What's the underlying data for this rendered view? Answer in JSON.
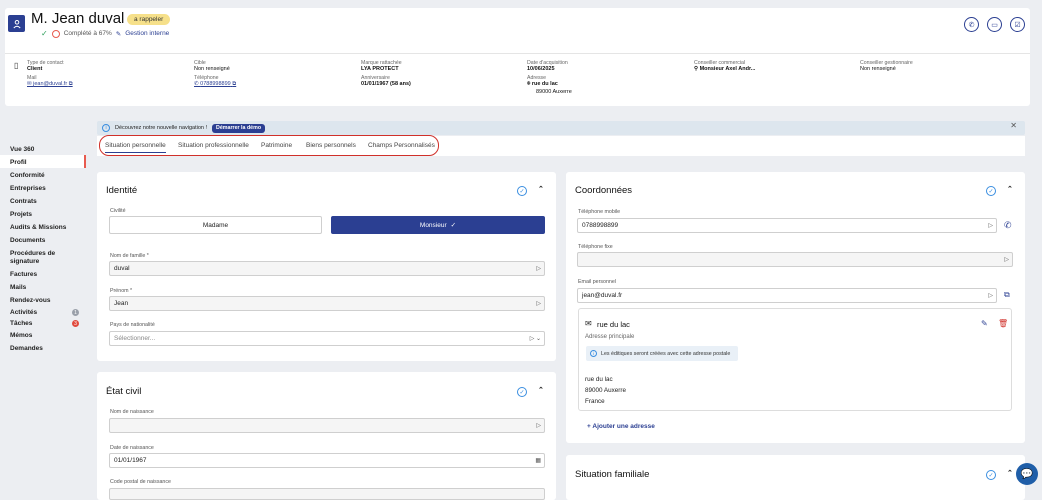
{
  "header": {
    "name": "M. Jean duval",
    "status_badge": "a rappeler",
    "completion": "Complété à 67%",
    "gestion_link": "Gestion interne",
    "fields": [
      {
        "label": "Type de contact",
        "value": "Client"
      },
      {
        "label": "Mail",
        "value": "jean@duval.fr"
      },
      {
        "label": "Cible",
        "value": "Non renseigné"
      },
      {
        "label": "Téléphone",
        "value": "0788998899"
      },
      {
        "label": "Marque rattachée",
        "value": "LYA PROTECT"
      },
      {
        "label": "Anniversaire",
        "value": "01/01/1967 (58 ans)"
      },
      {
        "label": "Date d'acquisition",
        "value": "10/06/2025"
      },
      {
        "label": "Adresse",
        "value": "rue du lac",
        "value2": "89000 Auxerre"
      },
      {
        "label": "Conseiller commercial",
        "value": "Monsieur Axel Andr..."
      },
      {
        "label": "Conseiller gestionnaire",
        "value": "Non renseigné"
      }
    ]
  },
  "sidebar": {
    "items": [
      "Vue 360",
      "Profil",
      "Conformité",
      "Entreprises",
      "Contrats",
      "Projets",
      "Audits & Missions",
      "Documents",
      "Procédures de signature",
      "Factures",
      "Mails",
      "Rendez-vous",
      "Activités",
      "Tâches",
      "Mémos",
      "Demandes"
    ],
    "badges": {
      "activites": "1",
      "taches": "3"
    }
  },
  "banner": {
    "text": "Découvrez notre nouvelle navigation !",
    "button": "Démarrer la démo"
  },
  "tabs": [
    "Situation personnelle",
    "Situation professionnelle",
    "Patrimoine",
    "Biens personnels",
    "Champs Personnalisés"
  ],
  "identite": {
    "title": "Identité",
    "civilite_label": "Civilité",
    "option_madame": "Madame",
    "option_monsieur": "Monsieur",
    "nom_label": "Nom de famille *",
    "nom_value": "duval",
    "prenom_label": "Prénom *",
    "prenom_value": "Jean",
    "pays_label": "Pays de nationalité",
    "pays_placeholder": "Sélectionner..."
  },
  "etat_civil": {
    "title": "État civil",
    "nom_naissance_label": "Nom de naissance",
    "date_naissance_label": "Date de naissance",
    "date_naissance_value": "01/01/1967",
    "cp_naissance_label": "Code postal de naissance"
  },
  "coordonnees": {
    "title": "Coordonnées",
    "tel_mobile_label": "Téléphone mobile",
    "tel_mobile_value": "0788998899",
    "tel_fixe_label": "Téléphone fixe",
    "email_label": "Email personnel",
    "email_value": "jean@duval.fr",
    "address_title": "rue du lac",
    "address_type": "Adresse principale",
    "address_note": "Les éditiques seront créées avec cette adresse postale",
    "address_lines": [
      "rue du lac",
      "89000 Auxerre",
      "France"
    ],
    "add_address": "Ajouter une adresse"
  },
  "situation_familiale": {
    "title": "Situation familiale"
  },
  "colors": {
    "primary": "#2b3f92",
    "accent": "#3a8ee0",
    "badge": "#f6e08a",
    "danger": "#d0302a"
  }
}
